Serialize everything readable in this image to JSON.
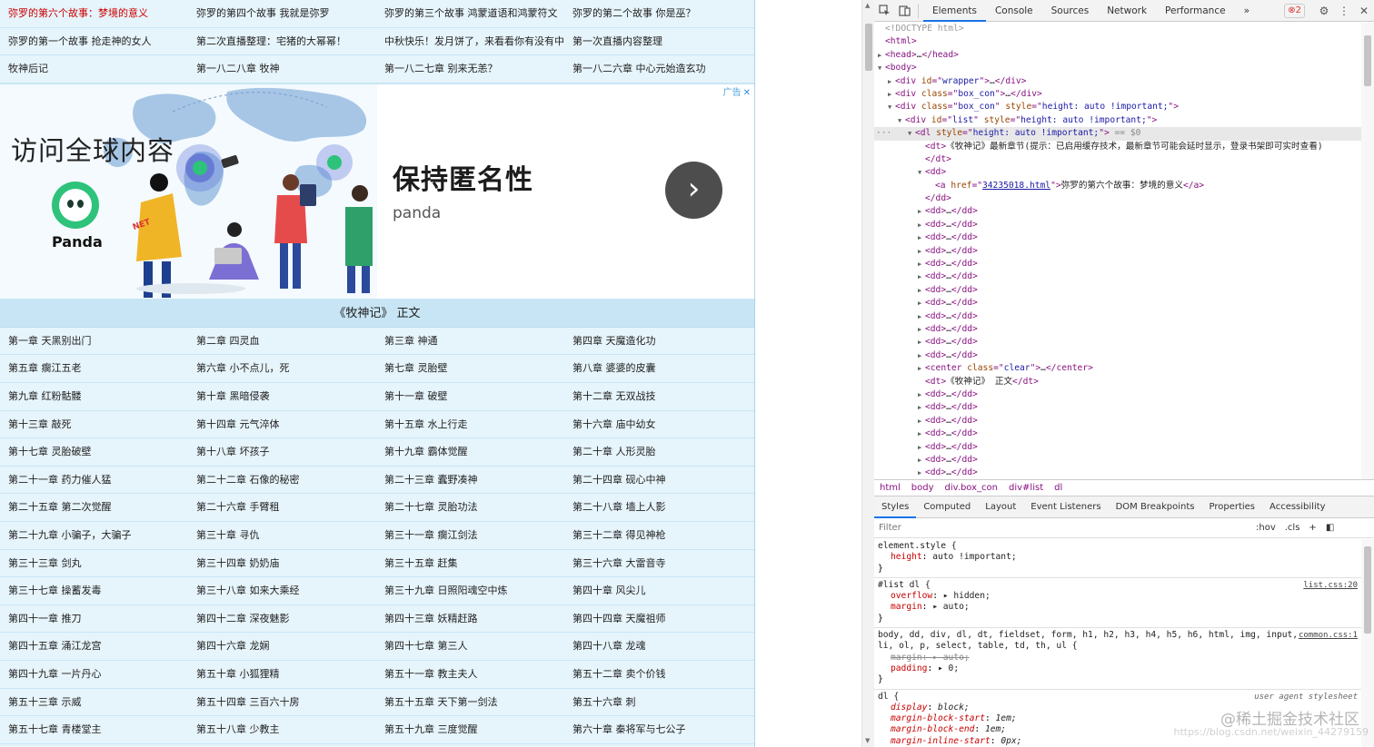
{
  "page": {
    "top_rows": [
      [
        "弥罗的第六个故事：梦境的意义",
        "弥罗的第四个故事 我就是弥罗",
        "弥罗的第三个故事 鸿蒙道语和鸿蒙符文",
        "弥罗的第二个故事 你是巫？"
      ],
      [
        "弥罗的第一个故事 抢走神的女人",
        "第二次直播整理：宅猪的大幂幂！",
        "中秋快乐！发月饼了，来看看你有没有中",
        "第一次直播内容整理"
      ],
      [
        "牧神后记",
        "第一八二八章 牧神",
        "第一八二七章 别来无恙？",
        "第一八二六章 中心元始造玄功"
      ]
    ],
    "ad": {
      "headline": "访问全球内容",
      "brand": "Panda",
      "title": "保持匿名性",
      "subtitle": "panda",
      "tag": "广告",
      "close": "✕",
      "arrow": "›",
      "sticker": "NET",
      "colors": {
        "accent": "#2fc27a",
        "arrow_bg": "#4d4d4d",
        "map": "#a7c6e6"
      }
    },
    "section_title": "《牧神记》 正文",
    "chapter_rows": [
      [
        "第一章 天黑别出门",
        "第二章 四灵血",
        "第三章 神通",
        "第四章 天魔造化功"
      ],
      [
        "第五章 瘸江五老",
        "第六章 小不点儿，死",
        "第七章 灵胎壁",
        "第八章 婆婆的皮囊"
      ],
      [
        "第九章 红粉骷髅",
        "第十章 黑暗侵袭",
        "第十一章 破壁",
        "第十二章 无双战技"
      ],
      [
        "第十三章 敲死",
        "第十四章 元气淬体",
        "第十五章 水上行走",
        "第十六章 庙中幼女"
      ],
      [
        "第十七章 灵胎破壁",
        "第十八章 坏孩子",
        "第十九章 霸体觉醒",
        "第二十章 人形灵胎"
      ],
      [
        "第二十一章 药力催人猛",
        "第二十二章 石像的秘密",
        "第二十三章 蠹野凑神",
        "第二十四章 砚心中神"
      ],
      [
        "第二十五章 第二次觉醒",
        "第二十六章 手臂租",
        "第二十七章 灵胎功法",
        "第二十八章 墙上人影"
      ],
      [
        "第二十九章 小骗子，大骗子",
        "第三十章 寻仇",
        "第三十一章 瘸江剑法",
        "第三十二章 得见神枪"
      ],
      [
        "第三十三章 剑丸",
        "第三十四章 奶奶庙",
        "第三十五章 赶集",
        "第三十六章 大雷音寺"
      ],
      [
        "第三十七章 操蓄发毒",
        "第三十八章 如来大乘经",
        "第三十九章 日照阳魂空中炼",
        "第四十章 风尖儿"
      ],
      [
        "第四十一章 推刀",
        "第四十二章 深夜魅影",
        "第四十三章 妖精赶路",
        "第四十四章 天魔祖师"
      ],
      [
        "第四十五章 涌江龙宫",
        "第四十六章 龙娴",
        "第四十七章 第三人",
        "第四十八章 龙魂"
      ],
      [
        "第四十九章 一片丹心",
        "第五十章 小狐狸精",
        "第五十一章 教主夫人",
        "第五十二章 卖个价钱"
      ],
      [
        "第五十三章 示威",
        "第五十四章 三百六十房",
        "第五十五章 天下第一剑法",
        "第五十六章 刺"
      ],
      [
        "第五十七章 青楼堂主",
        "第五十八章 少教主",
        "第五十九章 三度觉醒",
        "第六十章 秦将军与七公子"
      ]
    ]
  },
  "devtools": {
    "toolbar": {
      "tabs": [
        "Elements",
        "Console",
        "Sources",
        "Network",
        "Performance"
      ],
      "active_tab": "Elements",
      "more": "»",
      "error_count": "2",
      "icons": [
        "inspect-icon",
        "device-toggle-icon",
        "gear-icon",
        "kebab-menu-icon",
        "close-icon"
      ]
    },
    "dom_lines": [
      {
        "indent": 0,
        "tri": "",
        "html": "<span class='c-gray'>&lt;!DOCTYPE html&gt;</span>"
      },
      {
        "indent": 0,
        "tri": "",
        "html": "<span class='c-tag'>&lt;html&gt;</span>"
      },
      {
        "indent": 0,
        "tri": "▶",
        "html": "<span class='c-tag'>&lt;head&gt;</span><span class='c-text'>…</span><span class='c-tag'>&lt;/head&gt;</span>"
      },
      {
        "indent": 0,
        "tri": "▼",
        "html": "<span class='c-tag'>&lt;body&gt;</span>"
      },
      {
        "indent": 1,
        "tri": "▶",
        "html": "<span class='c-tag'>&lt;div </span><span class='c-attr'>id</span><span class='c-tag'>=\"</span><span class='c-val'>wrapper</span><span class='c-tag'>\"&gt;</span><span class='c-text'>…</span><span class='c-tag'>&lt;/div&gt;</span>"
      },
      {
        "indent": 1,
        "tri": "▶",
        "html": "<span class='c-tag'>&lt;div </span><span class='c-attr'>class</span><span class='c-tag'>=\"</span><span class='c-val'>box_con</span><span class='c-tag'>\"&gt;</span><span class='c-text'>…</span><span class='c-tag'>&lt;/div&gt;</span>"
      },
      {
        "indent": 1,
        "tri": "▼",
        "html": "<span class='c-tag'>&lt;div </span><span class='c-attr'>class</span><span class='c-tag'>=\"</span><span class='c-val'>box_con</span><span class='c-tag'>\" </span><span class='c-attr'>style</span><span class='c-tag'>=\"</span><span class='c-val'>height: auto !important;</span><span class='c-tag'>\"&gt;</span>"
      },
      {
        "indent": 2,
        "tri": "▼",
        "html": "<span class='c-tag'>&lt;div </span><span class='c-attr'>id</span><span class='c-tag'>=\"</span><span class='c-val'>list</span><span class='c-tag'>\" </span><span class='c-attr'>style</span><span class='c-tag'>=\"</span><span class='c-val'>height: auto !important;</span><span class='c-tag'>\"&gt;</span>"
      },
      {
        "indent": 3,
        "tri": "▼",
        "selected": true,
        "dots": "···",
        "html": "<span class='c-tag'>&lt;dl </span><span class='c-attr'>style</span><span class='c-tag'>=\"</span><span class='c-val'>height: auto !important;</span><span class='c-tag'>\"&gt;</span><span class='c-dim'> == $0</span>"
      },
      {
        "indent": 4,
        "tri": "",
        "html": "<span class='c-tag'>&lt;dt&gt;</span><span class='c-text'>《牧神记》最新章节(提示：已启用缓存技术，最新章节可能会延时显示，登录书架即可实时查看)</span>"
      },
      {
        "indent": 4,
        "tri": "",
        "html": "<span class='c-tag'>&lt;/dt&gt;</span>"
      },
      {
        "indent": 4,
        "tri": "▼",
        "html": "<span class='c-tag'>&lt;dd&gt;</span>"
      },
      {
        "indent": 5,
        "tri": "",
        "html": "<span class='c-tag'>&lt;a </span><span class='c-attr'>href</span><span class='c-tag'>=\"</span><span class='c-link'>34235018.html</span><span class='c-tag'>\"&gt;</span><span class='c-text'>弥罗的第六个故事：梦境的意义</span><span class='c-tag'>&lt;/a&gt;</span>"
      },
      {
        "indent": 4,
        "tri": "",
        "html": "<span class='c-tag'>&lt;/dd&gt;</span>"
      },
      {
        "indent": 4,
        "tri": "▶",
        "html": "<span class='c-tag'>&lt;dd&gt;</span><span class='c-text'>…</span><span class='c-tag'>&lt;/dd&gt;</span>"
      },
      {
        "indent": 4,
        "tri": "▶",
        "html": "<span class='c-tag'>&lt;dd&gt;</span><span class='c-text'>…</span><span class='c-tag'>&lt;/dd&gt;</span>"
      },
      {
        "indent": 4,
        "tri": "▶",
        "html": "<span class='c-tag'>&lt;dd&gt;</span><span class='c-text'>…</span><span class='c-tag'>&lt;/dd&gt;</span>"
      },
      {
        "indent": 4,
        "tri": "▶",
        "html": "<span class='c-tag'>&lt;dd&gt;</span><span class='c-text'>…</span><span class='c-tag'>&lt;/dd&gt;</span>"
      },
      {
        "indent": 4,
        "tri": "▶",
        "html": "<span class='c-tag'>&lt;dd&gt;</span><span class='c-text'>…</span><span class='c-tag'>&lt;/dd&gt;</span>"
      },
      {
        "indent": 4,
        "tri": "▶",
        "html": "<span class='c-tag'>&lt;dd&gt;</span><span class='c-text'>…</span><span class='c-tag'>&lt;/dd&gt;</span>"
      },
      {
        "indent": 4,
        "tri": "▶",
        "html": "<span class='c-tag'>&lt;dd&gt;</span><span class='c-text'>…</span><span class='c-tag'>&lt;/dd&gt;</span>"
      },
      {
        "indent": 4,
        "tri": "▶",
        "html": "<span class='c-tag'>&lt;dd&gt;</span><span class='c-text'>…</span><span class='c-tag'>&lt;/dd&gt;</span>"
      },
      {
        "indent": 4,
        "tri": "▶",
        "html": "<span class='c-tag'>&lt;dd&gt;</span><span class='c-text'>…</span><span class='c-tag'>&lt;/dd&gt;</span>"
      },
      {
        "indent": 4,
        "tri": "▶",
        "html": "<span class='c-tag'>&lt;dd&gt;</span><span class='c-text'>…</span><span class='c-tag'>&lt;/dd&gt;</span>"
      },
      {
        "indent": 4,
        "tri": "▶",
        "html": "<span class='c-tag'>&lt;dd&gt;</span><span class='c-text'>…</span><span class='c-tag'>&lt;/dd&gt;</span>"
      },
      {
        "indent": 4,
        "tri": "▶",
        "html": "<span class='c-tag'>&lt;dd&gt;</span><span class='c-text'>…</span><span class='c-tag'>&lt;/dd&gt;</span>"
      },
      {
        "indent": 4,
        "tri": "▶",
        "html": "<span class='c-tag'>&lt;center </span><span class='c-attr'>class</span><span class='c-tag'>=\"</span><span class='c-val'>clear</span><span class='c-tag'>\"&gt;</span><span class='c-text'>…</span><span class='c-tag'>&lt;/center&gt;</span>"
      },
      {
        "indent": 4,
        "tri": "",
        "html": "<span class='c-tag'>&lt;dt&gt;</span><span class='c-text'>《牧神记》 正文</span><span class='c-tag'>&lt;/dt&gt;</span>"
      },
      {
        "indent": 4,
        "tri": "▶",
        "html": "<span class='c-tag'>&lt;dd&gt;</span><span class='c-text'>…</span><span class='c-tag'>&lt;/dd&gt;</span>"
      },
      {
        "indent": 4,
        "tri": "▶",
        "html": "<span class='c-tag'>&lt;dd&gt;</span><span class='c-text'>…</span><span class='c-tag'>&lt;/dd&gt;</span>"
      },
      {
        "indent": 4,
        "tri": "▶",
        "html": "<span class='c-tag'>&lt;dd&gt;</span><span class='c-text'>…</span><span class='c-tag'>&lt;/dd&gt;</span>"
      },
      {
        "indent": 4,
        "tri": "▶",
        "html": "<span class='c-tag'>&lt;dd&gt;</span><span class='c-text'>…</span><span class='c-tag'>&lt;/dd&gt;</span>"
      },
      {
        "indent": 4,
        "tri": "▶",
        "html": "<span class='c-tag'>&lt;dd&gt;</span><span class='c-text'>…</span><span class='c-tag'>&lt;/dd&gt;</span>"
      },
      {
        "indent": 4,
        "tri": "▶",
        "html": "<span class='c-tag'>&lt;dd&gt;</span><span class='c-text'>…</span><span class='c-tag'>&lt;/dd&gt;</span>"
      },
      {
        "indent": 4,
        "tri": "▶",
        "html": "<span class='c-tag'>&lt;dd&gt;</span><span class='c-text'>…</span><span class='c-tag'>&lt;/dd&gt;</span>"
      }
    ],
    "breadcrumbs": [
      "html",
      "body",
      "div.box_con",
      "div#list",
      "dl"
    ],
    "sub_tabs": [
      "Styles",
      "Computed",
      "Layout",
      "Event Listeners",
      "DOM Breakpoints",
      "Properties",
      "Accessibility"
    ],
    "active_sub_tab": "Styles",
    "filter": {
      "placeholder": "Filter",
      "hov": ":hov",
      "cls": ".cls",
      "plus": "+",
      "toggle": "◧"
    },
    "styles": [
      {
        "selector": "element.style {",
        "source": "",
        "props": [
          {
            "n": "height",
            "v": "auto !important;"
          }
        ]
      },
      {
        "selector": "#list dl {",
        "source": "list.css:20",
        "props": [
          {
            "n": "overflow",
            "v": "▸ hidden;"
          },
          {
            "n": "margin",
            "v": "▸ auto;"
          }
        ]
      },
      {
        "selector": "body, dd, div, dl, dt, fieldset, form, h1, h2, h3, h4, h5, h6, html, img, input,",
        "selector2": "li, ol, p, select, table, td, th, ul {",
        "source": "common.css:1",
        "props": [
          {
            "n": "margin",
            "v": "▸ auto;",
            "struck": true
          },
          {
            "n": "padding",
            "v": "▸ 0;"
          }
        ]
      },
      {
        "selector": "dl {",
        "source": "user agent stylesheet",
        "ua": true,
        "props": [
          {
            "n": "display",
            "v": "block;"
          },
          {
            "n": "margin-block-start",
            "v": "1em;"
          },
          {
            "n": "margin-block-end",
            "v": "1em;"
          },
          {
            "n": "margin-inline-start",
            "v": "0px;"
          }
        ]
      }
    ]
  },
  "watermark": {
    "main": "@稀土掘金技术社区",
    "url": "https://blog.csdn.net/weixin_44279159"
  }
}
